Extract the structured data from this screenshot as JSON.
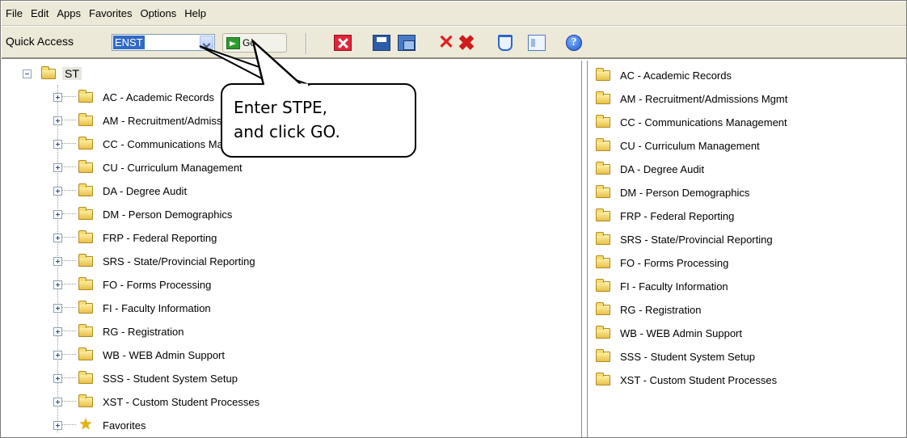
{
  "menu": [
    "File",
    "Edit",
    "Apps",
    "Favorites",
    "Options",
    "Help"
  ],
  "toolbar": {
    "quick_access_label": "Quick Access",
    "quick_access_value": "ENST",
    "go_label": "Go"
  },
  "icons": {
    "dropdown": "chevron-down-icon",
    "go": "go-arrow-icon",
    "close": "close-icon",
    "save": "save-icon",
    "save_all": "save-all-icon",
    "delete": "delete-icon",
    "delete_all": "delete-all-icon",
    "clear": "bucket-icon",
    "panel": "panel-icon",
    "help": "help-icon"
  },
  "colors": {
    "selection": "#316ac5",
    "toolbar_bg": "#ece9d8"
  },
  "tree": {
    "root": "ST",
    "items": [
      "AC - Academic Records",
      "AM - Recruitment/Admissions Mgmt",
      "CC - Communications Management",
      "CU - Curriculum Management",
      "DA - Degree Audit",
      "DM - Person Demographics",
      "FRP - Federal Reporting",
      "SRS - State/Provincial Reporting",
      "FO - Forms Processing",
      "FI - Faculty Information",
      "RG - Registration",
      "WB - WEB Admin Support",
      "SSS - Student System Setup",
      "XST - Custom Student Processes"
    ],
    "favorites": "Favorites"
  },
  "right_list": [
    "AC - Academic Records",
    "AM - Recruitment/Admissions Mgmt",
    "CC - Communications Management",
    "CU - Curriculum Management",
    "DA - Degree Audit",
    "DM - Person Demographics",
    "FRP - Federal Reporting",
    "SRS - State/Provincial Reporting",
    "FO - Forms Processing",
    "FI - Faculty Information",
    "RG - Registration",
    "WB - WEB Admin Support",
    "SSS - Student System Setup",
    "XST - Custom Student Processes"
  ],
  "callout": {
    "line1": "Enter STPE,",
    "line2": "and click GO."
  }
}
